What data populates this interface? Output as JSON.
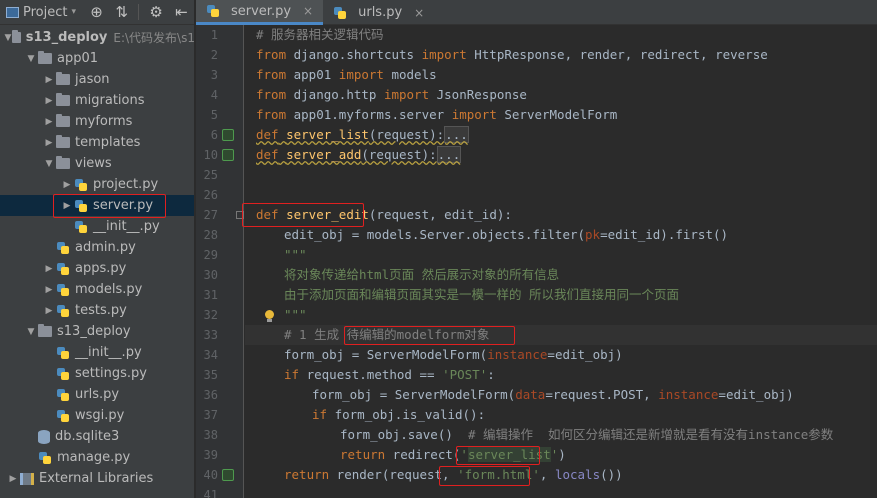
{
  "project_panel": {
    "title": "Project",
    "toolbar": {
      "sync_icon": "target-icon",
      "collapse_icon": "collapse-icon",
      "settings_icon": "gear-icon"
    }
  },
  "tree": [
    {
      "label": "s13_deploy",
      "hint": "E:\\代码发布\\s1",
      "type": "folder",
      "expanded": true,
      "depth": 0,
      "bold": true
    },
    {
      "label": "app01",
      "type": "folder",
      "expanded": true,
      "depth": 1
    },
    {
      "label": "jason",
      "type": "folder",
      "expanded": false,
      "depth": 2
    },
    {
      "label": "migrations",
      "type": "folder",
      "expanded": false,
      "depth": 2
    },
    {
      "label": "myforms",
      "type": "folder",
      "expanded": false,
      "depth": 2
    },
    {
      "label": "templates",
      "type": "folder",
      "expanded": false,
      "depth": 2
    },
    {
      "label": "views",
      "type": "folder",
      "expanded": true,
      "depth": 2
    },
    {
      "label": "project.py",
      "type": "py",
      "expanded": false,
      "depth": 3,
      "arrow": true
    },
    {
      "label": "server.py",
      "type": "py",
      "expanded": false,
      "depth": 3,
      "arrow": true,
      "selected": true
    },
    {
      "label": "__init__.py",
      "type": "py",
      "depth": 3
    },
    {
      "label": "admin.py",
      "type": "py",
      "depth": 2
    },
    {
      "label": "apps.py",
      "type": "py",
      "depth": 2,
      "arrow": true
    },
    {
      "label": "models.py",
      "type": "py",
      "depth": 2,
      "arrow": true
    },
    {
      "label": "tests.py",
      "type": "py",
      "depth": 2,
      "arrow": true
    },
    {
      "label": "s13_deploy",
      "type": "folder",
      "expanded": true,
      "depth": 1
    },
    {
      "label": "__init__.py",
      "type": "py",
      "depth": 2
    },
    {
      "label": "settings.py",
      "type": "py",
      "depth": 2
    },
    {
      "label": "urls.py",
      "type": "py",
      "depth": 2
    },
    {
      "label": "wsgi.py",
      "type": "py",
      "depth": 2
    },
    {
      "label": "db.sqlite3",
      "type": "db",
      "depth": 1
    },
    {
      "label": "manage.py",
      "type": "py",
      "depth": 1
    },
    {
      "label": "External Libraries",
      "type": "lib",
      "depth": 0,
      "arrow": true
    }
  ],
  "tabs": [
    {
      "label": "server.py",
      "active": true,
      "close": "×"
    },
    {
      "label": "urls.py",
      "active": false,
      "close": "×"
    }
  ],
  "code": {
    "line_numbers": [
      "1",
      "2",
      "3",
      "4",
      "5",
      "6",
      "10",
      "25",
      "26",
      "27",
      "28",
      "29",
      "30",
      "31",
      "32",
      "33",
      "34",
      "35",
      "36",
      "37",
      "38",
      "39",
      "40",
      "41"
    ],
    "comment_1": "# 服务器相关逻辑代码",
    "l2_kw1": "from",
    "l2_mod": " django.shortcuts ",
    "l2_kw2": "import",
    "l2_names": " HttpResponse, render, redirect, reverse",
    "l3_kw1": "from",
    "l3_mod": " app01 ",
    "l3_kw2": "import",
    "l3_names": " models",
    "l4_kw1": "from",
    "l4_mod": " django.http ",
    "l4_kw2": "import",
    "l4_names": " JsonResponse",
    "l5_kw1": "from",
    "l5_mod": " app01.myforms.server ",
    "l5_kw2": "import",
    "l5_names": " ServerModelForm",
    "l6_kw": "def",
    "l6_fn": "server_list",
    "l6_args": "(request):",
    "l6_fold": "...",
    "l10_kw": "def",
    "l10_fn": "server_add",
    "l10_args": "(request):",
    "l10_fold": "...",
    "l27_kw": "def",
    "l27_fn": "server_edit",
    "l27_args": "(request, edit_id):",
    "l28_a": "edit_obj = models.Server.objects.filter(",
    "l28_pm": "pk",
    "l28_b": "=edit_id).first()",
    "l29": "\"\"\"",
    "l30": "将对象传递给html页面 然后展示对象的所有信息",
    "l31": "由于添加页面和编辑页面其实是一模一样的 所以我们直接用同一个页面",
    "l32": "\"\"\"",
    "l33_a": "# 1 生成 ",
    "l33_b": "待编辑的modelform对象",
    "l34_a": "form_obj = ServerModelForm(",
    "l34_pm": "instance",
    "l34_b": "=edit_obj)",
    "l35_kw": "if",
    "l35_a": " request.method == ",
    "l35_st": "'POST'",
    "l35_b": ":",
    "l36_a": "form_obj = ServerModelForm(",
    "l36_pm1": "data",
    "l36_b": "=request.POST, ",
    "l36_pm2": "instance",
    "l36_c": "=edit_obj)",
    "l37_kw": "if",
    "l37_a": " form_obj.is_valid():",
    "l38_a": "form_obj.save()  ",
    "l38_cm": "# 编辑操作  如何区分编辑还是新增就是看有没有instance参数",
    "l39_kw": "return",
    "l39_a": " redirect(",
    "l39_q1": "'",
    "l39_st": "server_list",
    "l39_q2": "'",
    "l39_b": ")",
    "l40_kw": "return",
    "l40_a": " render(request, ",
    "l40_st": "'form.html'",
    "l40_b": ", ",
    "l40_bi": "locals",
    "l40_c": "())"
  }
}
